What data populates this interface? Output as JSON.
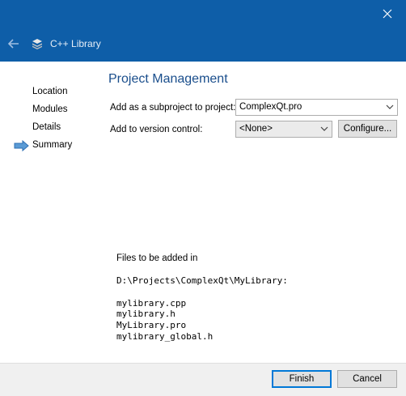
{
  "header": {
    "title": "C++ Library"
  },
  "sidebar": {
    "items": [
      {
        "label": "Location"
      },
      {
        "label": "Modules"
      },
      {
        "label": "Details"
      },
      {
        "label": "Summary",
        "current": true
      }
    ]
  },
  "main": {
    "title": "Project Management",
    "subproject_label": "Add as a subproject to project:",
    "subproject_value": "ComplexQt.pro",
    "vcs_label": "Add to version control:",
    "vcs_value": "<None>",
    "configure_label": "Configure...",
    "files_title": "Files to be added in",
    "files_path": "D:\\Projects\\ComplexQt\\MyLibrary:",
    "files": [
      "mylibrary.cpp",
      "mylibrary.h",
      "MyLibrary.pro",
      "mylibrary_global.h"
    ]
  },
  "footer": {
    "finish_label": "Finish",
    "cancel_label": "Cancel"
  },
  "colors": {
    "titlebar": "#0e5ea8",
    "page_title": "#1a4e8c",
    "accent_button_border": "#0078d7"
  },
  "icons": {
    "close": "close-icon",
    "back": "back-arrow-icon",
    "library": "library-icon",
    "current_step": "current-step-arrow-icon"
  }
}
